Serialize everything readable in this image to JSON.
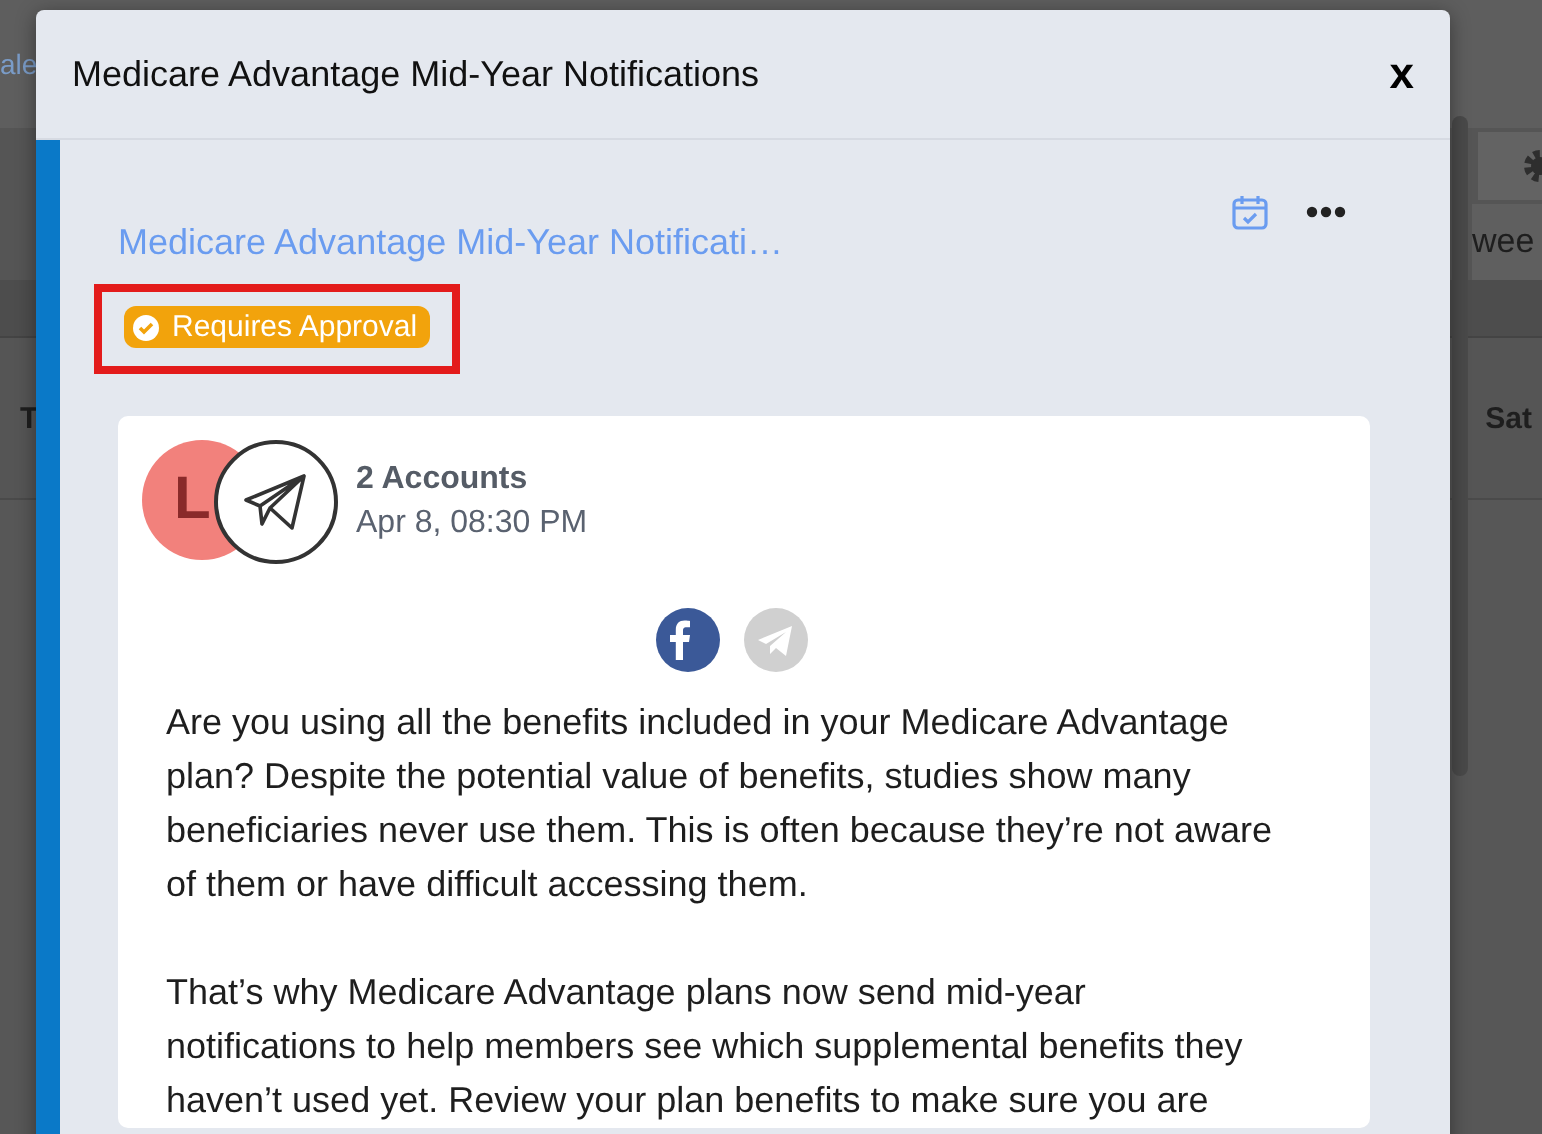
{
  "background": {
    "link_text": "ale",
    "view_select": "wee",
    "day_headers": [
      "T",
      "Sat"
    ]
  },
  "modal": {
    "title": "Medicare Advantage Mid-Year Notifications",
    "close": "x",
    "post": {
      "title": "Medicare Advantage Mid-Year Notificati…",
      "status": {
        "label": "Requires Approval",
        "highlighted": true
      },
      "avatar_letter": "L",
      "accounts": "2 Accounts",
      "time": "Apr 8, 08:30 PM",
      "networks": [
        {
          "kind": "facebook",
          "active": true
        },
        {
          "kind": "telegram",
          "active": false
        }
      ],
      "paragraphs": [
        "Are you using all the benefits included in your Medicare Advantage plan? Despite the potential value of benefits, studies show many beneficiaries never use them. This is often because they’re not aware of them or have difficult accessing them.",
        "That’s why Medicare Advantage plans now send mid-year notifications to help members see which supplemental benefits they haven’t used yet. Review your plan benefits to make sure you are"
      ]
    }
  }
}
